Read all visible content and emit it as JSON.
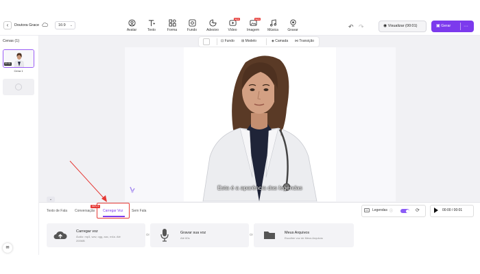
{
  "header": {
    "back_icon": "chevron-left-icon",
    "project_name": "Doutora Grace",
    "ratio": "16:9",
    "tools": [
      {
        "label": "Avatar",
        "icon": "avatar-icon"
      },
      {
        "label": "Texto",
        "icon": "text-icon"
      },
      {
        "label": "Forma",
        "icon": "shapes-icon"
      },
      {
        "label": "Fundo",
        "icon": "background-icon"
      },
      {
        "label": "Adesivo",
        "icon": "sticker-icon"
      },
      {
        "label": "Vídeo",
        "icon": "video-icon",
        "badge": "NEW"
      },
      {
        "label": "Imagem",
        "icon": "image-icon",
        "badge": "NEW"
      },
      {
        "label": "Música",
        "icon": "music-icon"
      },
      {
        "label": "Gravar",
        "icon": "record-icon"
      }
    ],
    "preview_label": "Visualizar (00:01)",
    "generate_label": "Gerar",
    "more_label": "···"
  },
  "sidebar": {
    "title": "Cenas (1)",
    "scenes": [
      {
        "label": "Cena 1",
        "duration": "00:01"
      }
    ]
  },
  "canvas_toolbar": {
    "items": [
      "Fundo",
      "Modelo",
      "Camada",
      "Transição"
    ]
  },
  "canvas": {
    "subtitle": "Esta é a aparência das legendas"
  },
  "bottom": {
    "tabs": [
      "Texto de Fala",
      "Conversação",
      "Carregar Voz",
      "Sem Fala"
    ],
    "active_tab": "Carregar Voz",
    "new_badge": "NOVO",
    "legend_label": "Legendas",
    "legend_cc": "CC",
    "legend_info": "ⓘ",
    "legend_on": true,
    "play_time": "00:00 / 00:01",
    "or_label": "Or",
    "cards": [
      {
        "title": "Carregar voz",
        "sub1": "Áudio: mp3, wav, ogg, aac, m4a. Até",
        "sub2": "200MB",
        "icon": "cloud-upload-icon"
      },
      {
        "title": "Gravar sua voz",
        "sub1": "Até 60s",
        "sub2": "",
        "icon": "microphone-icon"
      },
      {
        "title": "Meus Arquivos",
        "sub1": "Escolher voz de Meus Arquivos",
        "sub2": "",
        "icon": "folder-icon"
      }
    ]
  },
  "colors": {
    "accent": "#7c3aed",
    "highlight": "#e53935"
  }
}
